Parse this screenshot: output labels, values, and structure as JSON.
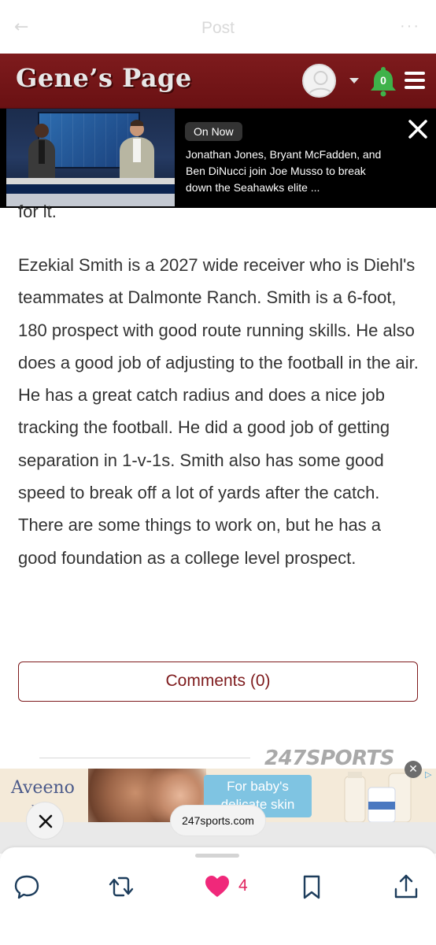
{
  "topbar": {
    "back_icon": "arrow-left-icon",
    "title": "Post",
    "more_icon": "more-dots-icon"
  },
  "site_header": {
    "logo_text": "Gene’s Page",
    "notification_count": "0",
    "colors": {
      "header_bg": "#7e1b1d",
      "bell": "#3fb24a"
    }
  },
  "video_banner": {
    "badge": "On Now",
    "description": "Jonathan Jones, Bryant McFadden, and Ben DiNucci join Joe Musso to break down the Seahawks elite ...",
    "close_icon": "close-icon"
  },
  "article": {
    "partial_line": "for it.",
    "paragraph": "Ezekial Smith is a 2027 wide receiver who is Diehl's teammates at Dalmonte Ranch. Smith is a 6-foot, 180 prospect with good route running skills. He also does a good job of adjusting to the football in the air. He has a great catch radius and does a nice job tracking the football. He did a good job of getting separation in 1-v-1s. Smith also has some good speed to break off a lot of yards after the catch. There are some things to work on, but he has a good foundation as a college level prospect."
  },
  "comments_button": {
    "label": "Comments (0)"
  },
  "footer_brand": "247SPORTS",
  "ad": {
    "brand": "Aveeno",
    "brand_sub": "baby",
    "headline_line1": "For baby's",
    "headline_line2": "delicate skin"
  },
  "browser_overlay": {
    "url": "247sports.com"
  },
  "actions": {
    "likes": "4",
    "like_color": "#e0245e"
  }
}
